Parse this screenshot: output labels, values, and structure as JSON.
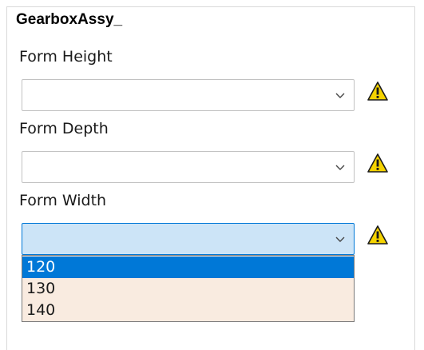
{
  "panel": {
    "title": "GearboxAssy_"
  },
  "fields": [
    {
      "label": "Form Height",
      "value": "",
      "warning_icon": "warning-triangle-icon"
    },
    {
      "label": "Form Depth",
      "value": "",
      "warning_icon": "warning-triangle-icon"
    },
    {
      "label": "Form Width",
      "value": "",
      "warning_icon": "warning-triangle-icon"
    }
  ],
  "dropdown": {
    "options": [
      "120",
      "130",
      "140"
    ],
    "highlighted_option": "120"
  },
  "colors": {
    "accent": "#0078d7",
    "active_field_bg": "#cce4f7",
    "dropdown_bg": "#f9ebe0",
    "warning_fill": "#f5d300"
  }
}
